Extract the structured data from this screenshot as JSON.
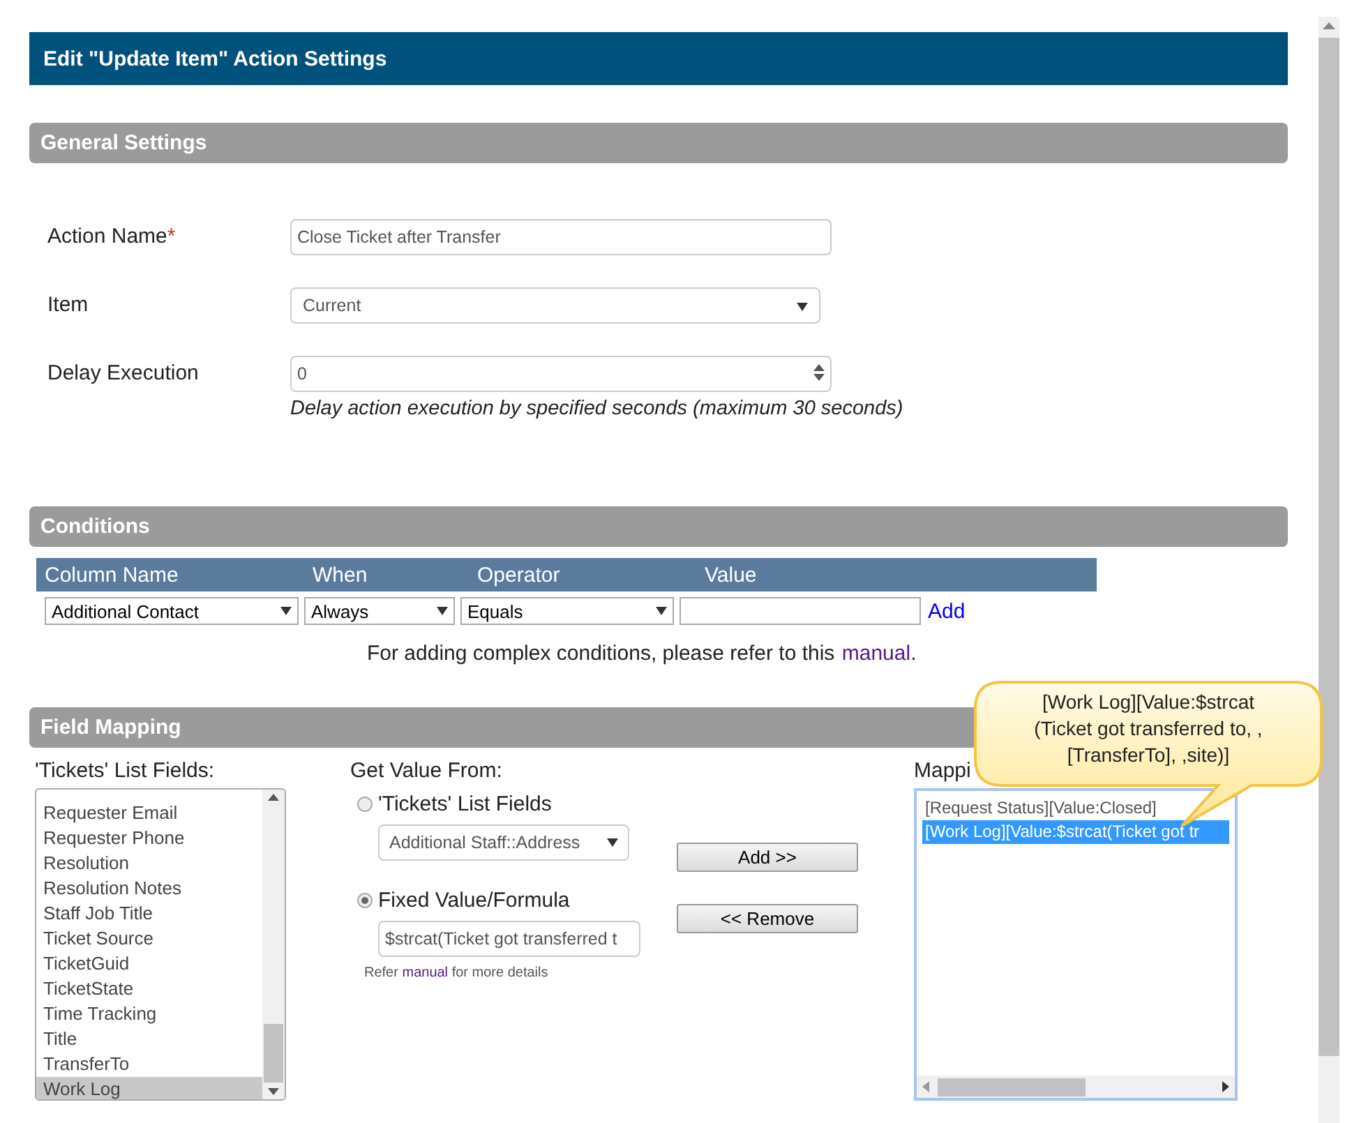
{
  "dialog_title": "Edit \"Update Item\" Action Settings",
  "general": {
    "heading": "General Settings",
    "required_mark": "*",
    "fields": [
      {
        "kind": "text",
        "label": "Action Name",
        "required": true,
        "value": "Close Ticket after Transfer"
      },
      {
        "kind": "select",
        "label": "Item",
        "required": false,
        "value": "Current"
      },
      {
        "kind": "number",
        "label": "Delay Execution",
        "required": false,
        "value": "0",
        "hint": "Delay action execution by specified seconds (maximum 30 seconds)"
      }
    ]
  },
  "conditions": {
    "heading": "Conditions",
    "columns": [
      "Column Name",
      "When",
      "Operator",
      "Value"
    ],
    "row": {
      "column_name": "Additional Contact",
      "when": "Always",
      "operator": "Equals"
    },
    "add_link": "Add",
    "note_before": "For adding complex conditions, please refer to this ",
    "note_link": "manual",
    "note_after": "."
  },
  "mapping": {
    "heading": "Field Mapping",
    "list_label": "'Tickets' List Fields:",
    "list_items": [
      {
        "label": "Requester Email",
        "selected": false
      },
      {
        "label": "Requester Phone",
        "selected": false
      },
      {
        "label": "Resolution",
        "selected": false
      },
      {
        "label": "Resolution Notes",
        "selected": false
      },
      {
        "label": "Staff Job Title",
        "selected": false
      },
      {
        "label": "Ticket Source",
        "selected": false
      },
      {
        "label": "TicketGuid",
        "selected": false
      },
      {
        "label": "TicketState",
        "selected": false
      },
      {
        "label": "Time Tracking",
        "selected": false
      },
      {
        "label": "Title",
        "selected": false
      },
      {
        "label": "TransferTo",
        "selected": false
      },
      {
        "label": "Work Log",
        "selected": true
      }
    ],
    "get_value_label": "Get Value From:",
    "sources": [
      {
        "kind": "select",
        "label": "'Tickets' List Fields",
        "selected": false,
        "value": "Additional Staff::Address"
      },
      {
        "kind": "text",
        "label": "Fixed Value/Formula",
        "selected": true,
        "value": "$strcat(Ticket got transferred t"
      }
    ],
    "help_before": "Refer ",
    "help_link": "manual",
    "help_after": " for more details",
    "buttons": [
      "Add >>",
      "<< Remove"
    ],
    "mappings_label": "Mappi",
    "mappings": [
      {
        "label": "[Request Status][Value:Closed]",
        "selected": false
      },
      {
        "label": "[Work Log][Value:$strcat(Ticket got tr",
        "selected": true
      }
    ],
    "callout_lines": [
      "[Work Log][Value:$strcat",
      "(Ticket got transferred to, ,",
      "[TransferTo], ,site)]"
    ]
  }
}
